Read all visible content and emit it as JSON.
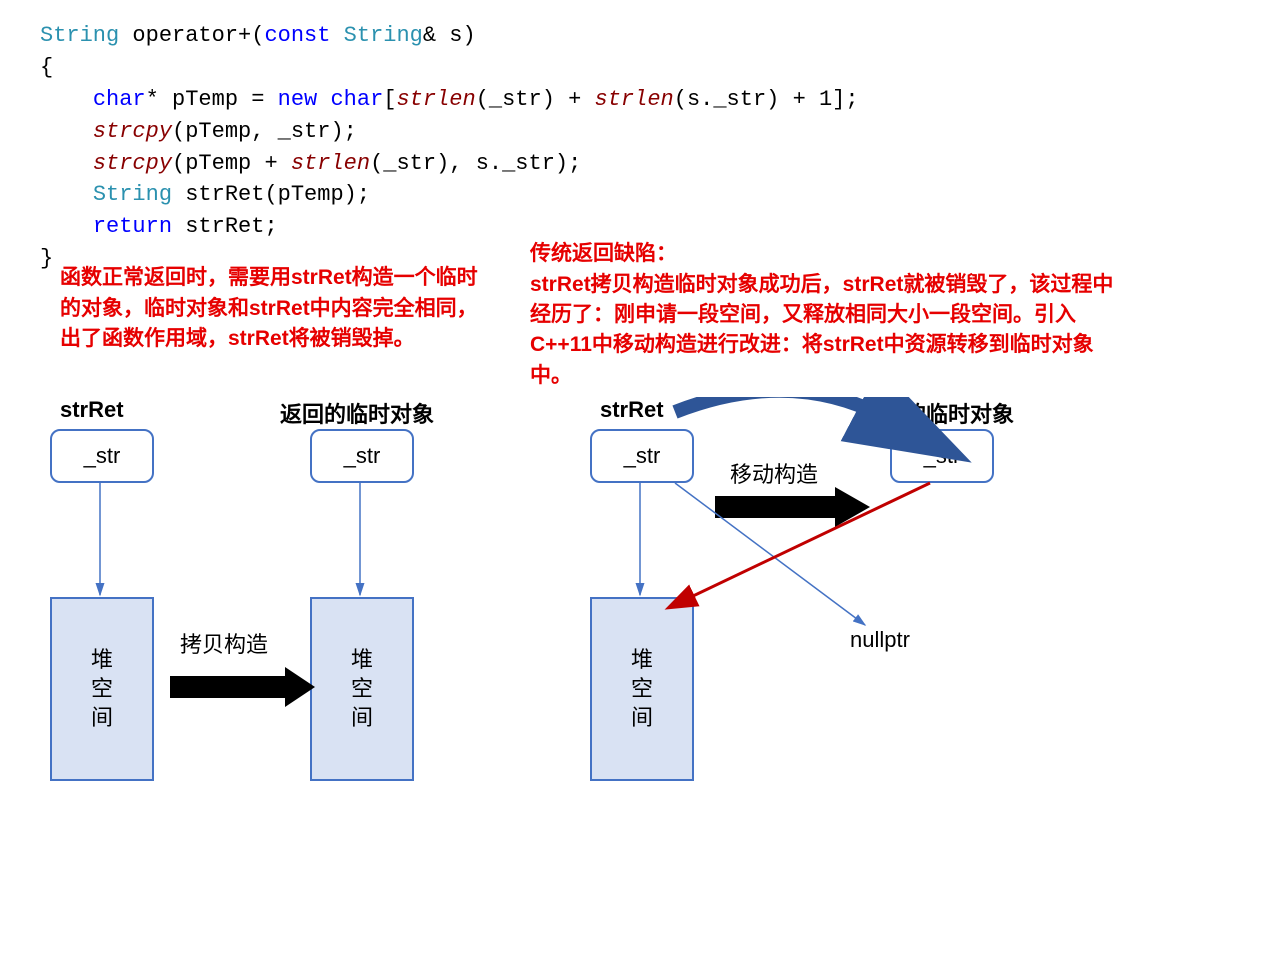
{
  "code": {
    "line1_type": "String",
    "line1_rest": " operator+(",
    "line1_const": "const",
    "line1_type2": " String",
    "line1_end": "& s)",
    "line2": "{",
    "line3_kw1": "char",
    "line3_txt1": "* pTemp = ",
    "line3_kw2": "new",
    "line3_txt2": " ",
    "line3_kw3": "char",
    "line3_txt3": "[",
    "line3_fn1": "strlen",
    "line3_txt4": "(_str) + ",
    "line3_fn2": "strlen",
    "line3_txt5": "(s._str) + 1];",
    "line4_fn": "strcpy",
    "line4_txt": "(pTemp, _str);",
    "line5_fn1": "strcpy",
    "line5_txt1": "(pTemp + ",
    "line5_fn2": "strlen",
    "line5_txt2": "(_str), s._str);",
    "line6_type": "String",
    "line6_txt": " strRet(pTemp);",
    "line7_kw": "return",
    "line7_txt": " strRet;",
    "line8": "}"
  },
  "notes": {
    "left": "函数正常返回时，需要用strRet构造一个临时的对象，临时对象和strRet中内容完全相同，出了函数作用域，strRet将被销毁掉。",
    "right": "传统返回缺陷：\nstrRet拷贝构造临时对象成功后，strRet就被销毁了，该过程中经历了：刚申请一段空间，又释放相同大小一段空间。引入C++11中移动构造进行改进：将strRet中资源转移到临时对象中。"
  },
  "diagram": {
    "strRet": "strRet",
    "tempObj": "返回的临时对象",
    "str": "_str",
    "heap": "堆\n空\n间",
    "copyCtor": "拷贝构造",
    "moveCtor": "移动构造",
    "nullptr": "nullptr"
  }
}
